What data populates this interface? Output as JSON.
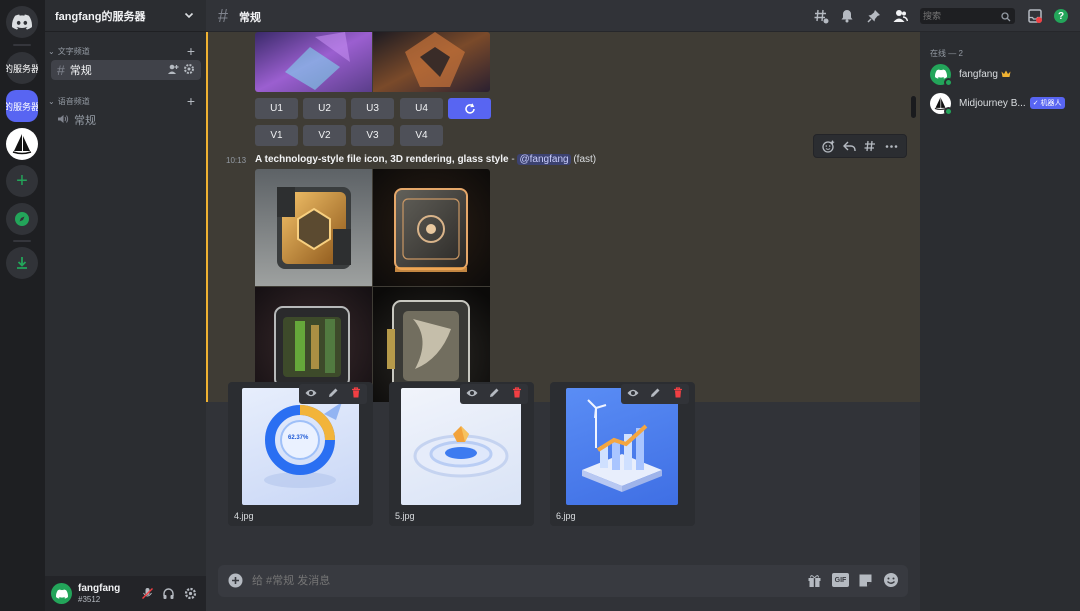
{
  "servers": [
    {
      "label": "的服务器"
    },
    {
      "label": "的服务器"
    }
  ],
  "server": {
    "name": "fangfang的服务器"
  },
  "sidebar": {
    "text_category": "文字频道",
    "voice_category": "语音频道",
    "text_channel": "常规",
    "voice_channel": "常规"
  },
  "user_panel": {
    "name": "fangfang",
    "tag": "#3512"
  },
  "topbar": {
    "channel_name": "常规",
    "search_placeholder": "搜索"
  },
  "chat": {
    "upscale_buttons": [
      "U1",
      "U2",
      "U3",
      "U4"
    ],
    "variation_buttons": [
      "V1",
      "V2",
      "V3",
      "V4"
    ],
    "message": {
      "time": "10:13",
      "prompt": "A technology-style file icon, 3D rendering, glass style",
      "separator": " - ",
      "mention": "@fangfang",
      "suffix": " (fast)"
    }
  },
  "attachments": [
    {
      "name": "4.jpg",
      "overlay_text": "62.37%"
    },
    {
      "name": "5.jpg"
    },
    {
      "name": "6.jpg"
    }
  ],
  "composer": {
    "placeholder": "给 #常规 发消息"
  },
  "members": {
    "heading": "在线 — 2",
    "list": [
      {
        "name": "fangfang"
      },
      {
        "name": "Midjourney B...",
        "badge": "✓ 机器人"
      }
    ]
  },
  "colors": {
    "accent": "#5865f2",
    "online": "#23a55a",
    "highlight": "#f0b232",
    "mention_bg": "#3c4270",
    "mention_fg": "#c9cdfb"
  }
}
